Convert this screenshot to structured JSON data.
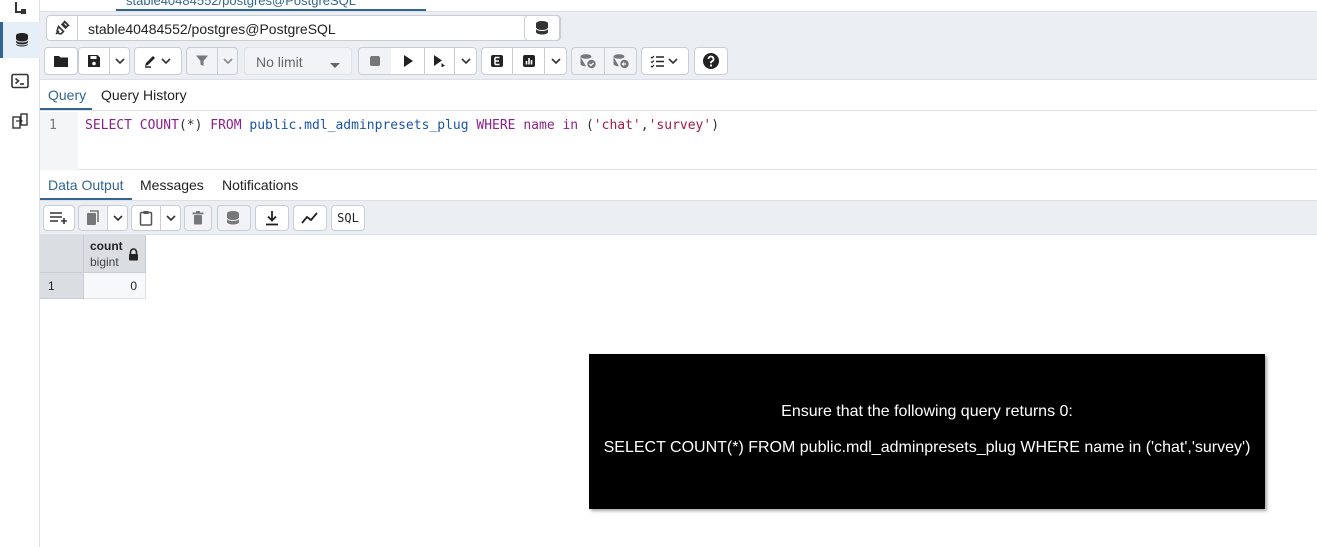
{
  "window": {
    "tab_title": "stable40484552/postgres@PostgreSQL"
  },
  "connection": {
    "label": "stable40484552/postgres@PostgreSQL"
  },
  "toolbar": {
    "limit_value": "No limit"
  },
  "query_tabs": [
    {
      "label": "Query"
    },
    {
      "label": "Query History"
    }
  ],
  "editor": {
    "line_number": "1",
    "tokens": {
      "select": "SELECT",
      "count": "COUNT",
      "paren_star": "(*)",
      "from": "FROM",
      "table": "public.mdl_adminpresets_plug",
      "where": "WHERE",
      "col": "name",
      "in": "in",
      "open": "(",
      "v1": "'chat'",
      "comma": ",",
      "v2": "'survey'",
      "close": ")"
    }
  },
  "output_tabs": [
    {
      "label": "Data Output"
    },
    {
      "label": "Messages"
    },
    {
      "label": "Notifications"
    }
  ],
  "output_toolbar": {
    "sql_label": "SQL"
  },
  "grid": {
    "columns": [
      {
        "name": "count",
        "type": "bigint"
      }
    ],
    "rows": [
      {
        "row_number": "1",
        "values": [
          "0"
        ]
      }
    ]
  },
  "overlay": {
    "line1": "Ensure that the following query returns 0:",
    "line2": "SELECT COUNT(*) FROM public.mdl_adminpresets_plug WHERE name in ('chat','survey')"
  },
  "colors": {
    "accent": "#326690",
    "toolbar_bg": "#ebeef3",
    "overlay_bg": "#000000"
  }
}
